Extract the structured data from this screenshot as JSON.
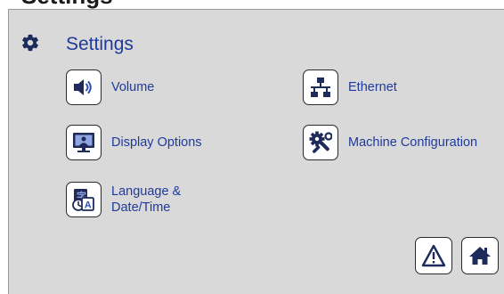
{
  "header": {
    "partial_title": "Settings"
  },
  "page": {
    "title": "Settings"
  },
  "items": [
    {
      "label": "Volume",
      "icon": "speaker-icon"
    },
    {
      "label": "Ethernet",
      "icon": "network-icon"
    },
    {
      "label": "Display Options",
      "icon": "monitor-icon"
    },
    {
      "label": "Machine Configuration",
      "icon": "tools-icon"
    },
    {
      "label": "Language &\nDate/Time",
      "icon": "language-clock-icon"
    }
  ],
  "footer": {
    "warning_icon": "warning-icon",
    "home_icon": "home-icon"
  },
  "colors": {
    "panel_bg": "#d9d9d9",
    "label_text": "#1f3a9c",
    "icon_dark": "#2a2a2a",
    "accent_blue": "#2d4fb3"
  }
}
